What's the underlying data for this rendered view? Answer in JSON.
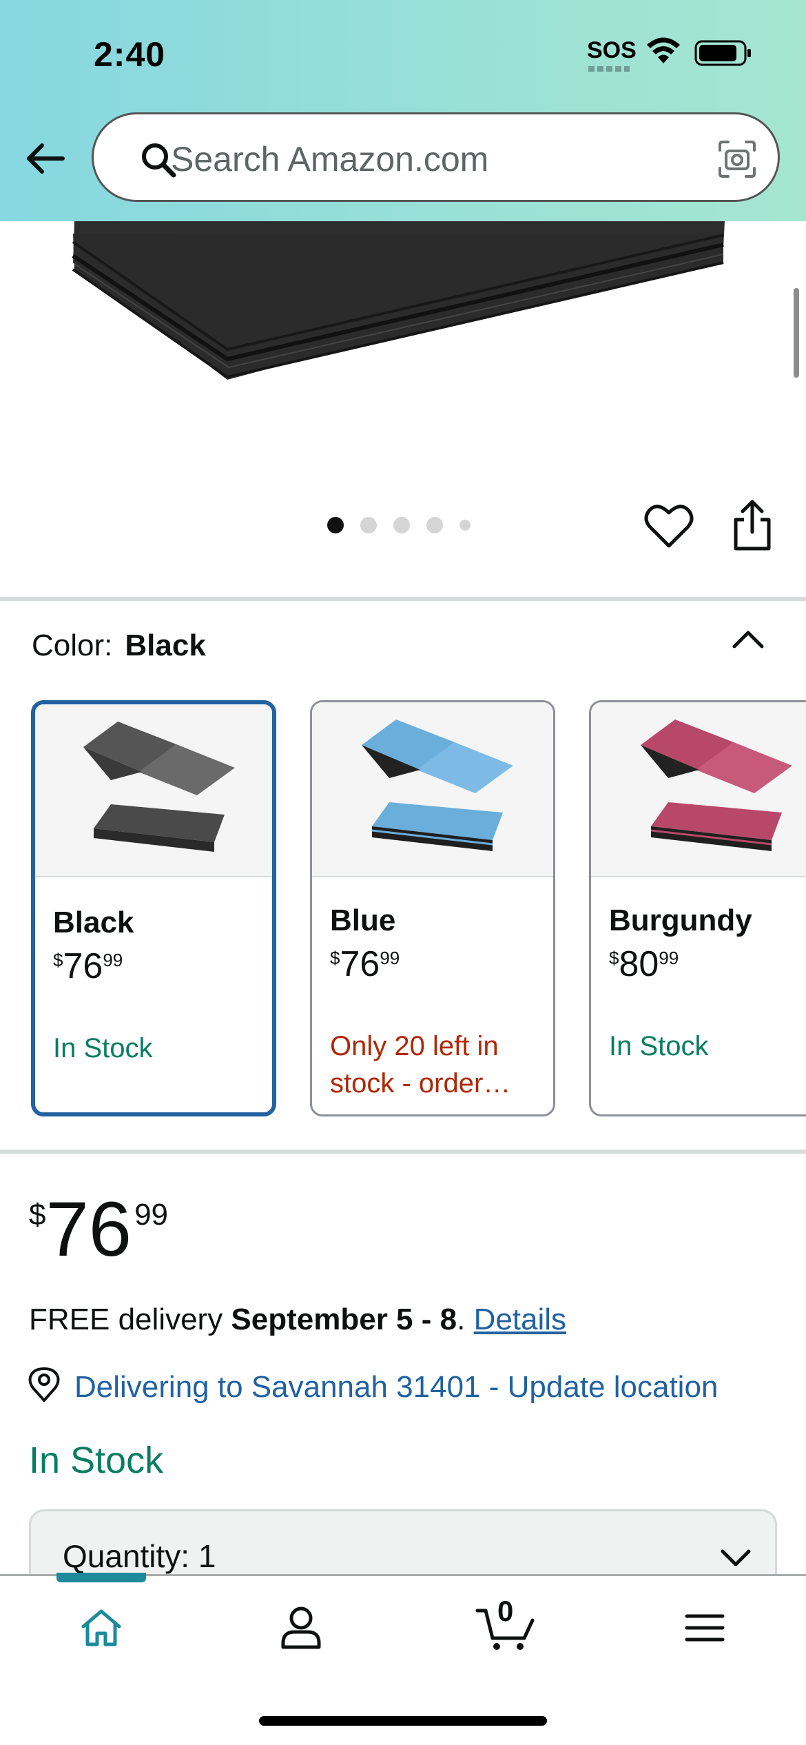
{
  "status_bar": {
    "time": "2:40",
    "sos": "SOS"
  },
  "header": {
    "search_placeholder": "Search Amazon.com"
  },
  "carousel": {
    "total_dots": 5,
    "active_index": 0
  },
  "color_selector": {
    "label": "Color:",
    "selected": "Black",
    "options": [
      {
        "name": "Black",
        "price_symbol": "$",
        "price_whole": "76",
        "price_fraction": "99",
        "availability": "In Stock",
        "availability_color": "#067d62",
        "mat_color": "#555555"
      },
      {
        "name": "Blue",
        "price_symbol": "$",
        "price_whole": "76",
        "price_fraction": "99",
        "availability": "Only 20 left in stock - order…",
        "availability_color": "#b12704",
        "mat_color": "#6aaedc"
      },
      {
        "name": "Burgundy",
        "price_symbol": "$",
        "price_whole": "80",
        "price_fraction": "99",
        "availability": "In Stock",
        "availability_color": "#067d62",
        "mat_color": "#b8486a"
      }
    ]
  },
  "price": {
    "symbol": "$",
    "whole": "76",
    "fraction": "99"
  },
  "delivery": {
    "prefix": "FREE delivery ",
    "dates": "September 5 - 8",
    "separator": ". ",
    "details_link": "Details"
  },
  "location": {
    "text": "Delivering to Savannah 31401 - Update location"
  },
  "stock_status": "In Stock",
  "quantity": {
    "label": "Quantity:",
    "value": "1"
  },
  "bottom_nav": {
    "items": [
      "home-icon",
      "account-icon",
      "cart-icon",
      "menu-icon"
    ],
    "cart_count": "0",
    "accent": "#1c8a9c"
  }
}
